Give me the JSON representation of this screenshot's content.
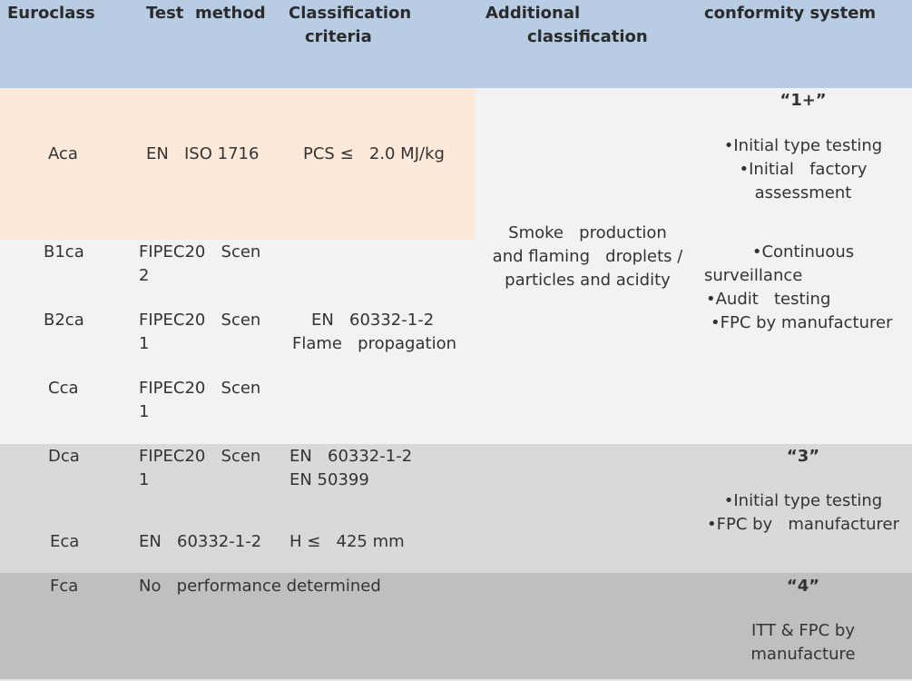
{
  "colors": {
    "header_bg": "#b8cce4",
    "class_a_bg": "#fde9d9",
    "class_b_c_bg": "#f2f2f2",
    "class_d_e_bg": "#d9d9d9",
    "class_f_bg": "#bfbfbf",
    "text": "#333333"
  },
  "header": {
    "euroclass": "Euroclass",
    "test_method": "Test  method",
    "classification_criteria_1": "Classification",
    "classification_criteria_2": "criteria",
    "additional_classification_1": "Additional",
    "additional_classification_2": "classification",
    "conformity_system": "conformity system"
  },
  "rows": {
    "aca": {
      "euroclass": "Aca",
      "test_method": "EN   ISO 1716",
      "criteria": "PCS ≤   2.0 MJ/kg"
    },
    "b1ca": {
      "euroclass": "B1ca",
      "test_method_1": "FIPEC20   Scen",
      "test_method_2": "2"
    },
    "b2ca": {
      "euroclass": "B2ca",
      "test_method_1": "FIPEC20   Scen",
      "test_method_2": "1",
      "criteria_1": "EN   60332-1-2",
      "criteria_2": "Flame   propagation"
    },
    "cca": {
      "euroclass": "Cca",
      "test_method_1": "FIPEC20   Scen",
      "test_method_2": "1"
    },
    "dca": {
      "euroclass": "Dca",
      "test_method_1": "FIPEC20   Scen",
      "test_method_2": "1",
      "criteria_1": "EN   60332-1-2",
      "criteria_2": "EN 50399"
    },
    "eca": {
      "euroclass": "Eca",
      "test_method": "EN   60332-1-2",
      "criteria": "H ≤   425 mm"
    },
    "fca": {
      "euroclass": "Fca",
      "test_method": "No   performance determined"
    }
  },
  "additional_classification": {
    "line_1": "Smoke   production",
    "line_2": "and flaming   droplets /",
    "line_3": "particles and acidity"
  },
  "conformity": {
    "system_1plus": {
      "label": "“1+”",
      "line_1": "•Initial type testing",
      "line_2": "•Initial   factory",
      "line_3": "assessment",
      "line_4": "•Continuous",
      "line_5": "surveillance",
      "line_6": "•Audit   testing",
      "line_7": "•FPC by manufacturer"
    },
    "system_3": {
      "label": "“3”",
      "line_1": "•Initial type testing",
      "line_2": "•FPC by   manufacturer"
    },
    "system_4": {
      "label": "“4”",
      "line_1": "ITT & FPC by",
      "line_2": "manufacture"
    }
  }
}
